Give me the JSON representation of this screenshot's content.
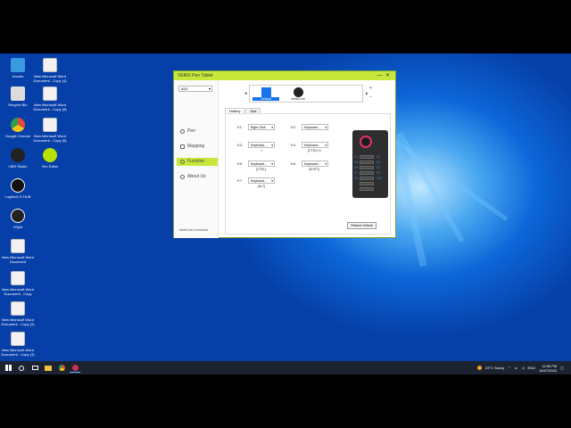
{
  "desktop_icons": [
    {
      "label": "Ubuntu",
      "color": "#3a9ae0"
    },
    {
      "label": "Recycle Bin",
      "color": "#dcdcdc"
    },
    {
      "label": "Google Chrome",
      "color": "#e04b3a"
    },
    {
      "label": "OBS Studio",
      "color": "#222222"
    },
    {
      "label": "Logitech G HUB",
      "color": "#111111"
    },
    {
      "label": "XSplit",
      "color": "#222222"
    },
    {
      "label": "New Microsoft Word Document",
      "color": "#f2f2f2"
    },
    {
      "label": "New Microsoft Word Document - Copy",
      "color": "#f2f2f2"
    },
    {
      "label": "New Microsoft Word Document - Copy (2)",
      "color": "#f2f2f2"
    },
    {
      "label": "New Microsoft Word Document - Copy (3)",
      "color": "#f2f2f2"
    }
  ],
  "desktop_icons_col2": [
    {
      "label": "New Microsoft Word Document - Copy (4)"
    },
    {
      "label": "New Microsoft Word Document - Copy (5)"
    },
    {
      "label": "New Microsoft Word Document - Copy (6)"
    },
    {
      "label": "Vim Editor",
      "color": "#b8e000"
    }
  ],
  "window": {
    "title": "VEIKK Pen Tablet",
    "min": "—",
    "close": "✕",
    "device": "A15",
    "nav": {
      "pen": "Pen",
      "mapping": "Mapping",
      "function": "Function",
      "about": "About Us"
    },
    "status": "tablet has connected",
    "apps": [
      {
        "name": "Default"
      },
      {
        "name": "obs64.exe"
      }
    ],
    "tabs": {
      "hotkey": "Hotkey",
      "dial": "Dial"
    },
    "keys": {
      "k1": "K1:",
      "k1_val": "Right Click",
      "k2": "K2:",
      "k2_val": "Keyboard...",
      "k3": "K3:",
      "k3_val": "Keyboard...",
      "k3_sub": "+",
      "k4": "K4:",
      "k4_val": "Keyboard...",
      "k4_sub": "[CTRL]+z",
      "k5": "K5:",
      "k5_val": "Keyboard...",
      "k5_sub": "[CTRL]",
      "k6": "K6:",
      "k6_val": "Keyboard...",
      "k6_sub": "[SHIFT]",
      "k7": "K7:",
      "k7_val": "Keyboard...",
      "k7_sub": "[ALT]"
    },
    "tablet_labels": {
      "k1": "K1",
      "k2": "K2",
      "k3": "K3",
      "k4": "K4",
      "k5": "K5",
      "k6": "K6",
      "k7": "K7",
      "k8": "K8",
      "k9": "K9",
      "k10": "K10"
    },
    "restore": "Restore Default"
  },
  "taskbar": {
    "weather": "23°C  Sunny",
    "lang": "ENG",
    "time": "12:56 PM",
    "date": "16/07/2022"
  }
}
